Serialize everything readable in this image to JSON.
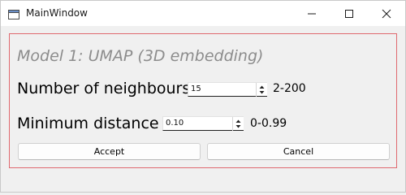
{
  "window": {
    "title": "MainWindow"
  },
  "panel": {
    "heading": "Model 1: UMAP (3D embedding)",
    "neighbours": {
      "label": "Number of neighbours",
      "value": "15",
      "range": "2-200"
    },
    "distance": {
      "label": "Minimum distance",
      "value": "0.10",
      "range": "0-0.99"
    },
    "accept_label": "Accept",
    "cancel_label": "Cancel"
  },
  "colors": {
    "frame_border": "#e0696f",
    "heading": "#8c8c8c"
  }
}
